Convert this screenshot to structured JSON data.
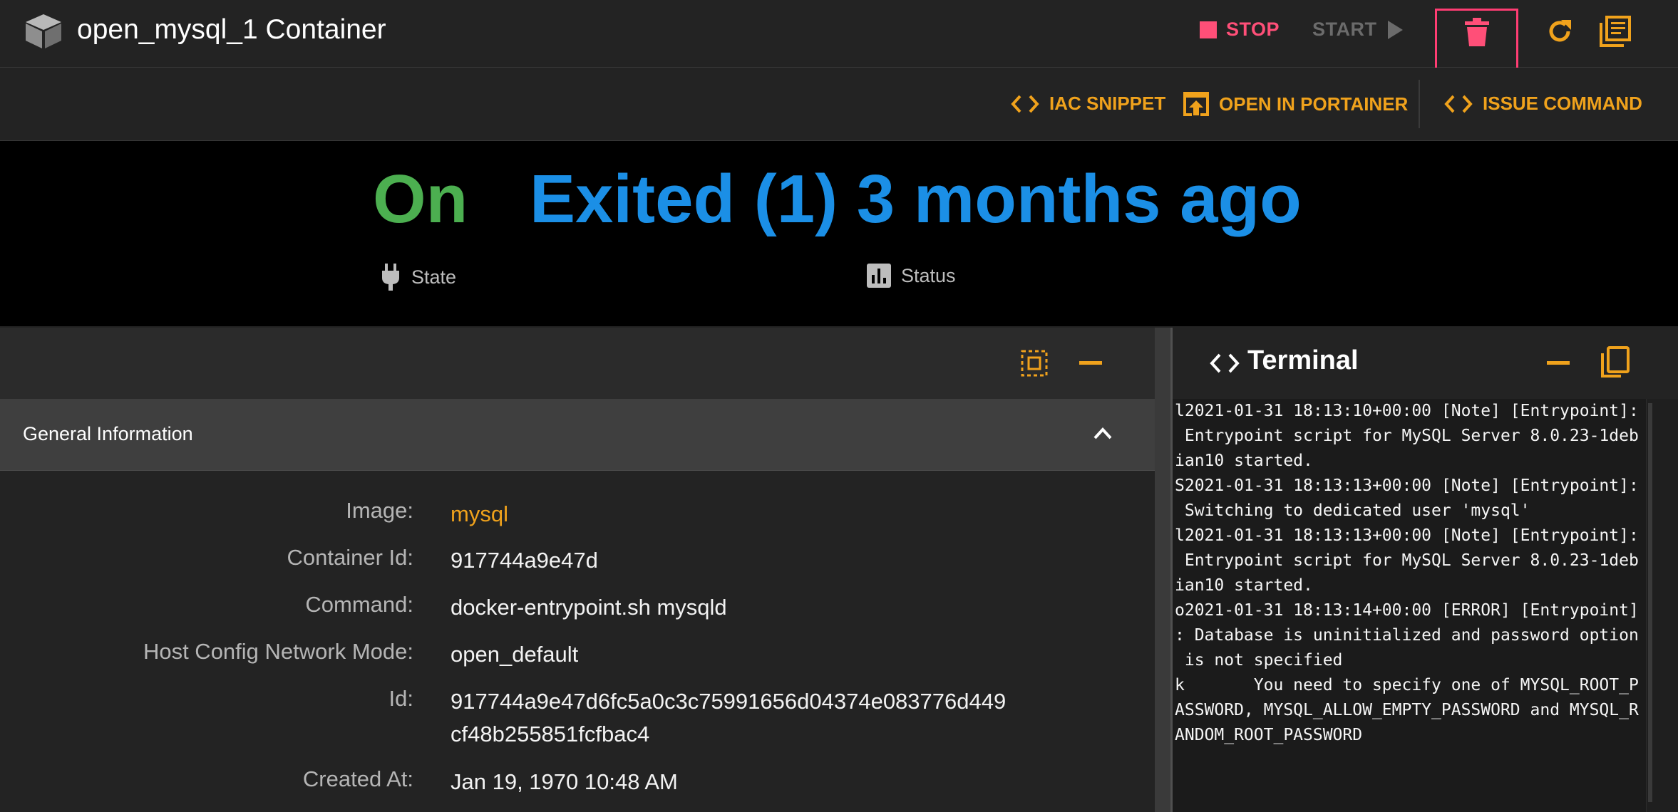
{
  "header": {
    "title": "open_mysql_1 Container",
    "stop_label": "STOP",
    "start_label": "START"
  },
  "toolbar": {
    "iac_label": "IAC SNIPPET",
    "portainer_label": "OPEN IN PORTAINER",
    "issue_label": "ISSUE COMMAND"
  },
  "status": {
    "state_value": "On",
    "state_label": "State",
    "status_value": "Exited (1) 3 months ago",
    "status_label": "Status"
  },
  "section": {
    "title": "General Information"
  },
  "info": {
    "image_label": "Image:",
    "image_value": "mysql",
    "container_id_label": "Container Id:",
    "container_id_value": "917744a9e47d",
    "command_label": "Command:",
    "command_value": "docker-entrypoint.sh mysqld",
    "network_label": "Host Config Network Mode:",
    "network_value": "open_default",
    "id_label": "Id:",
    "id_value_1": "917744a9e47d6fc5a0c3c75991656d04374e083776d449",
    "id_value_2": "cf48b255851fcfbac4",
    "created_label": "Created At:",
    "created_value": "Jan 19, 1970 10:48 AM"
  },
  "terminal": {
    "title": "Terminal",
    "lines": [
      "l2021-01-31 18:13:10+00:00 [Note] [Entrypoint]:",
      " Entrypoint script for MySQL Server 8.0.23-1deb",
      "ian10 started.",
      "S2021-01-31 18:13:13+00:00 [Note] [Entrypoint]:",
      " Switching to dedicated user 'mysql'",
      "l2021-01-31 18:13:13+00:00 [Note] [Entrypoint]:",
      " Entrypoint script for MySQL Server 8.0.23-1deb",
      "ian10 started.",
      "o2021-01-31 18:13:14+00:00 [ERROR] [Entrypoint]",
      ": Database is uninitialized and password option",
      " is not specified",
      "k       You need to specify one of MYSQL_ROOT_P",
      "ASSWORD, MYSQL_ALLOW_EMPTY_PASSWORD and MYSQL_R",
      "ANDOM_ROOT_PASSWORD"
    ]
  },
  "colors": {
    "accent": "#f0a21c",
    "stop": "#ff4f78",
    "state_on": "#4caf50",
    "status_blue": "#1b8fe6"
  },
  "icons": {
    "container": "cube-icon",
    "stop": "stop-square-icon",
    "start": "play-icon",
    "delete": "trash-icon",
    "refresh": "refresh-icon",
    "logs": "library-books-icon",
    "code": "code-icon",
    "open": "open-in-browser-icon",
    "state": "plug-icon",
    "status": "bar-chart-icon",
    "fit": "fit-screen-icon",
    "minimize": "minus-icon",
    "collapse": "chevron-up-icon",
    "copy": "copy-icon"
  }
}
